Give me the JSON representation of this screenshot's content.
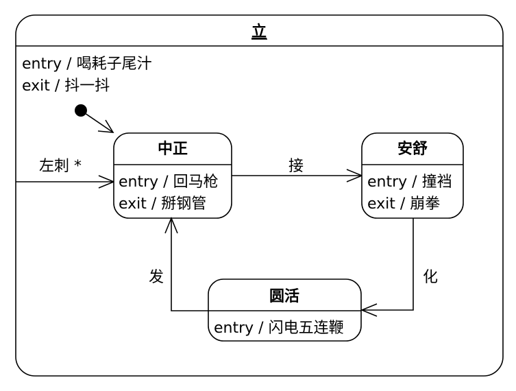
{
  "diagram": {
    "type": "uml-state-machine",
    "composite_state": {
      "name": "立",
      "entry_action": "entry / 喝耗子尾汁",
      "exit_action": "exit / 抖一抖"
    },
    "states": [
      {
        "id": "zhongzheng",
        "name": "中正",
        "entry_action": "entry / 回马枪",
        "exit_action": "exit / 掰钢管"
      },
      {
        "id": "anshu",
        "name": "安舒",
        "entry_action": "entry / 撞裆",
        "exit_action": "exit / 崩拳"
      },
      {
        "id": "yuanhuo",
        "name": "圆活",
        "entry_action": "entry / 闪电五连鞭"
      }
    ],
    "transitions": [
      {
        "from": "initial",
        "to": "zhongzheng",
        "label": ""
      },
      {
        "from": "composite-boundary",
        "to": "zhongzheng",
        "label": "左刺 *"
      },
      {
        "from": "zhongzheng",
        "to": "anshu",
        "label": "接"
      },
      {
        "from": "anshu",
        "to": "yuanhuo",
        "label": "化"
      },
      {
        "from": "yuanhuo",
        "to": "zhongzheng",
        "label": "发"
      }
    ]
  }
}
